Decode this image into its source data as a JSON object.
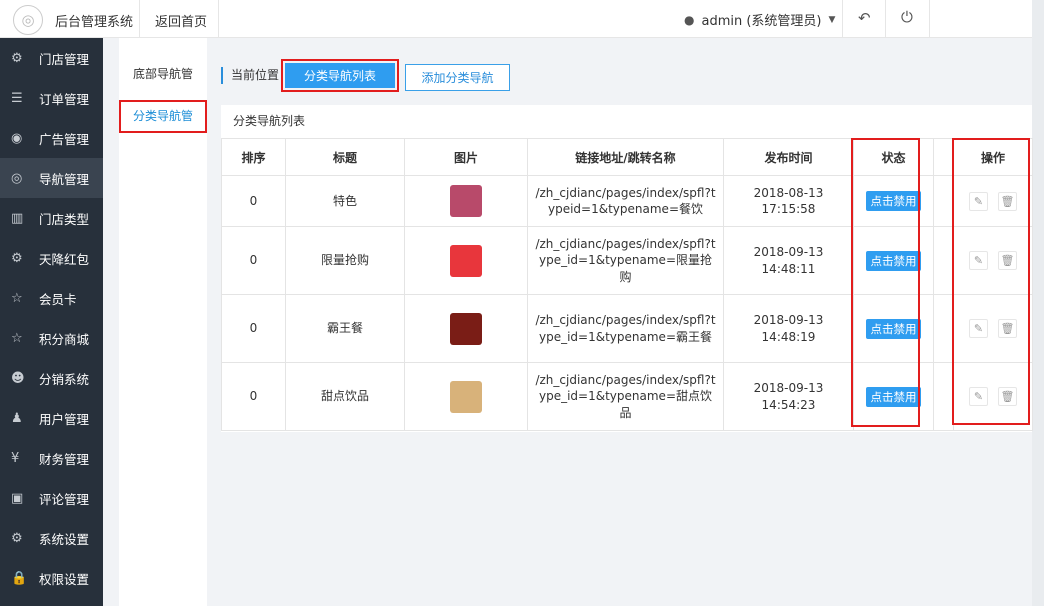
{
  "header": {
    "logo_glyph": "◎",
    "app_title": "后台管理系统",
    "home_link": "返回首页",
    "user_label": "admin (系统管理员)",
    "user_icon": "user-icon",
    "back_icon": "undo-icon",
    "logout_icon": "power-icon"
  },
  "sidebar": {
    "items": [
      {
        "icon": "⚙",
        "label": "门店管理"
      },
      {
        "icon": "☰",
        "label": "订单管理"
      },
      {
        "icon": "◉",
        "label": "广告管理"
      },
      {
        "icon": "◎",
        "label": "导航管理"
      },
      {
        "icon": "▥",
        "label": "门店类型"
      },
      {
        "icon": "⚙",
        "label": "天降红包"
      },
      {
        "icon": "☆",
        "label": "会员卡"
      },
      {
        "icon": "☆",
        "label": "积分商城"
      },
      {
        "icon": "☻",
        "label": "分销系统"
      },
      {
        "icon": "♟",
        "label": "用户管理"
      },
      {
        "icon": "¥",
        "label": "财务管理"
      },
      {
        "icon": "▣",
        "label": "评论管理"
      },
      {
        "icon": "⚙",
        "label": "系统设置"
      },
      {
        "icon": "🔒",
        "label": "权限设置"
      }
    ]
  },
  "subnav": {
    "items": [
      "底部导航管",
      "分类导航管"
    ]
  },
  "breadcrumb": {
    "label": "当前位置"
  },
  "buttons": {
    "list": "分类导航列表",
    "add": "添加分类导航"
  },
  "panel": {
    "title": "分类导航列表"
  },
  "table": {
    "columns": [
      "排序",
      "标题",
      "图片",
      "链接地址/跳转名称",
      "发布时间",
      "状态",
      "",
      "操作"
    ],
    "rows": [
      {
        "sort": "0",
        "title": "特色",
        "link": "/zh_cjdianc/pages/index/spfl?typeid=1&typename=餐饮",
        "date": "2018-08-13",
        "time": "17:15:58",
        "status": "点击禁用",
        "thumb": "#b84a6a"
      },
      {
        "sort": "0",
        "title": "限量抢购",
        "link": "/zh_cjdianc/pages/index/spfl?type_id=1&typename=限量抢购",
        "date": "2018-09-13",
        "time": "14:48:11",
        "status": "点击禁用",
        "thumb": "#e8363c"
      },
      {
        "sort": "0",
        "title": "霸王餐",
        "link": "/zh_cjdianc/pages/index/spfl?type_id=1&typename=霸王餐",
        "date": "2018-09-13",
        "time": "14:48:19",
        "status": "点击禁用",
        "thumb": "#7a1d16"
      },
      {
        "sort": "0",
        "title": "甜点饮品",
        "link": "/zh_cjdianc/pages/index/spfl?type_id=1&typename=甜点饮品",
        "date": "2018-09-13",
        "time": "14:54:23",
        "status": "点击禁用",
        "thumb": "#d8b27a"
      }
    ]
  },
  "icons": {
    "edit": "edit-icon",
    "delete": "trash-icon"
  },
  "colors": {
    "accent": "#2f9df0",
    "highlight": "#e21d1d",
    "sidebar": "#27303b"
  }
}
